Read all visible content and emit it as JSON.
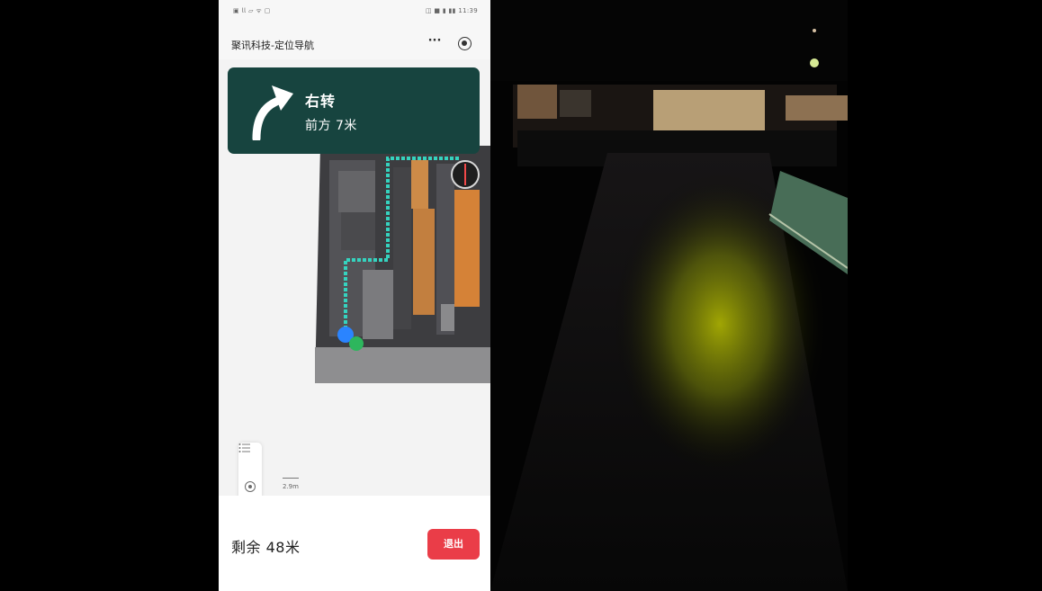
{
  "status_bar": {
    "left": "▣ 𝗅𝗅 ▱ ᯤ ▢",
    "right": "◫ ■ ▮ ▮▮ 11:39"
  },
  "header": {
    "title": "聚讯科技-定位导航",
    "more_icon": "more-icon",
    "target_icon": "target-icon"
  },
  "navigation": {
    "instruction": "右转",
    "distance": "前方 7米"
  },
  "map": {
    "scale": "2.9m",
    "list_icon": "list-icon",
    "locate_icon": "locate-icon",
    "route_color": "#35d3bf",
    "wall_color": "#4f4f52",
    "floor_color": "#3a3a3c",
    "orange_color": "#d2843c"
  },
  "footer": {
    "remaining": "剩余 48米",
    "exit_label": "退出"
  },
  "camera": {
    "light_color": "#c9d000"
  }
}
